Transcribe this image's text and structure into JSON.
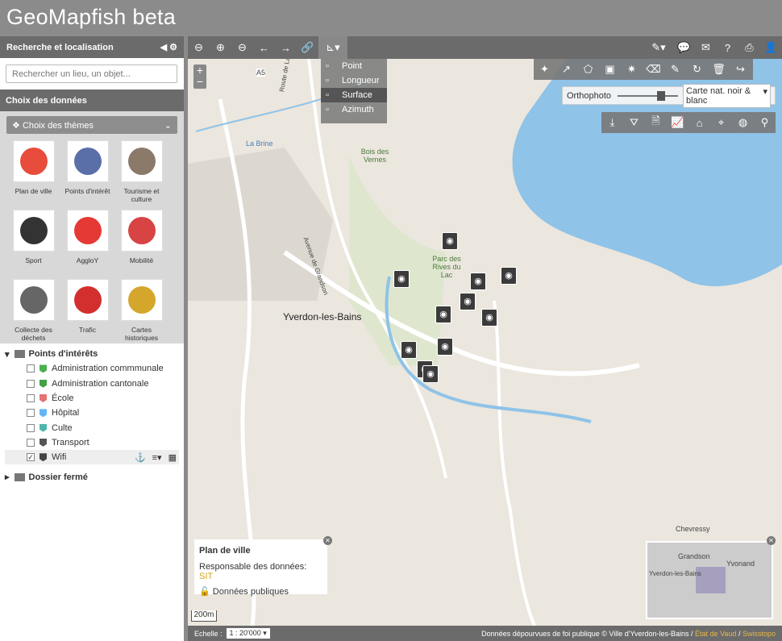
{
  "app": {
    "title": "GeoMapfish beta"
  },
  "panel": {
    "title": "Recherche et localisation",
    "search_placeholder": "Rechercher un lieu, un objet...",
    "data_title": "Choix des données",
    "themes_button": "Choix des thèmes",
    "themes": [
      {
        "label": "Plan de ville",
        "icon": "map-icon",
        "color": "#e74c3c"
      },
      {
        "label": "Points d'intérêt",
        "icon": "eye-icon",
        "color": "#5a6fa8"
      },
      {
        "label": "Tourisme et culture",
        "icon": "museum-icon",
        "color": "#8b7a6a"
      },
      {
        "label": "Sport",
        "icon": "soccer-ball-icon",
        "color": "#333"
      },
      {
        "label": "AggloY",
        "icon": "heart-icon",
        "color": "#e53935"
      },
      {
        "label": "Mobilité",
        "icon": "person-icon",
        "color": "#d84343"
      },
      {
        "label": "Collecte des déchets",
        "icon": "trash-icon",
        "color": "#666"
      },
      {
        "label": "Trafic",
        "icon": "bus-icon",
        "color": "#d32f2f"
      },
      {
        "label": "Cartes historiques",
        "icon": "books-icon",
        "color": "#d4a72c"
      }
    ],
    "tree": {
      "group": "Points d'intérêts",
      "layers": [
        {
          "label": "Administration commmunale",
          "color": "#4caf50",
          "checked": false
        },
        {
          "label": "Administration cantonale",
          "color": "#43a047",
          "checked": false
        },
        {
          "label": "École",
          "color": "#e57373",
          "checked": false
        },
        {
          "label": "Hôpital",
          "color": "#64b5f6",
          "checked": false
        },
        {
          "label": "Culte",
          "color": "#4db6ac",
          "checked": false
        },
        {
          "label": "Transport",
          "color": "#555",
          "checked": false
        },
        {
          "label": "Wifi",
          "color": "#444",
          "checked": true
        }
      ],
      "folder": "Dossier fermé"
    }
  },
  "measure_menu": {
    "items": [
      {
        "label": "Point",
        "icon": "point-icon"
      },
      {
        "label": "Longueur",
        "icon": "line-measure-icon"
      },
      {
        "label": "Surface",
        "icon": "surface-icon"
      },
      {
        "label": "Azimuth",
        "icon": "azimuth-icon"
      }
    ]
  },
  "ortho": {
    "label": "Orthophoto",
    "select": "Carte nat. noir & blanc",
    "value": 0.75
  },
  "map": {
    "city": "Yverdon-les-Bains",
    "labels": [
      "Bois des Vernes",
      "Parc des Rives du Lac",
      "Chevressy",
      "Grandson",
      "Yvonand",
      "La Brine",
      "A5",
      "Route de Lausanne",
      "Avenue de Grandson"
    ]
  },
  "infobox": {
    "title": "Plan de ville",
    "resp_label": "Responsable des données:",
    "resp_value": "SIT",
    "public": "Données publiques"
  },
  "minimap": {
    "labels": [
      "Grandson",
      "Yvonand",
      "Yverdon-les-Bains"
    ]
  },
  "scale": {
    "bar": "200m",
    "label": "Echelle :",
    "value": "1 : 20'000"
  },
  "footer": {
    "copyright": "Données dépourvues de foi publique © Ville d'Yverdon-les-Bains /",
    "vaud": "État de Vaud",
    "swisstopo": "Swisstopo",
    "sep": "/"
  }
}
